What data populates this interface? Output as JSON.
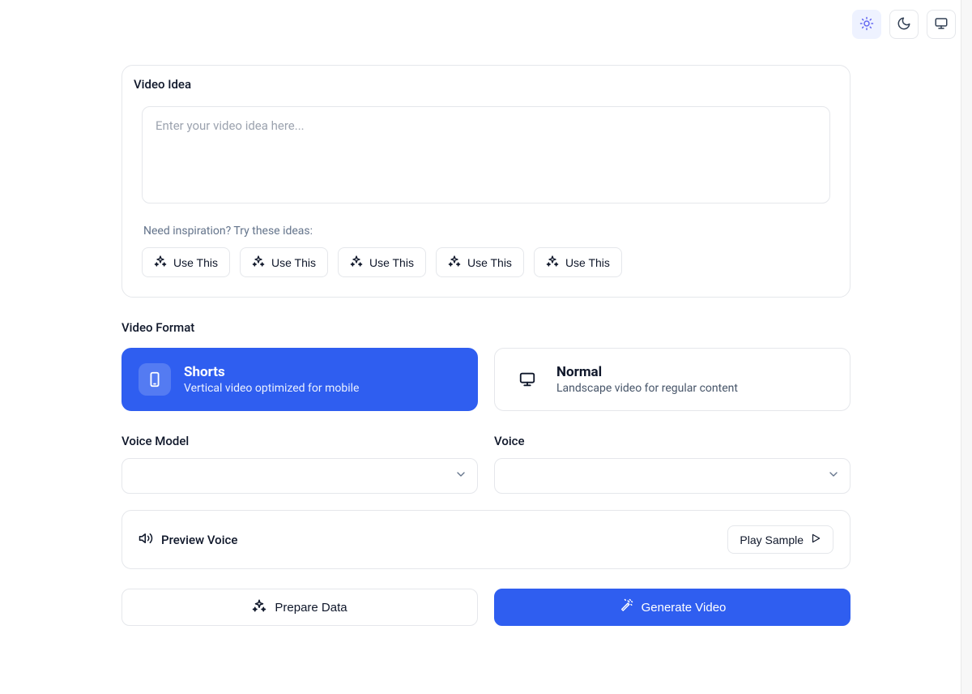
{
  "topbar": {
    "light_tooltip": "Light theme",
    "dark_tooltip": "Dark theme",
    "system_tooltip": "System theme"
  },
  "idea": {
    "title": "Video Idea",
    "placeholder": "Enter your video idea here...",
    "value": "",
    "inspiration_label": "Need inspiration? Try these ideas:",
    "suggestions": [
      {
        "label": "Use This"
      },
      {
        "label": "Use This"
      },
      {
        "label": "Use This"
      },
      {
        "label": "Use This"
      },
      {
        "label": "Use This"
      }
    ]
  },
  "format": {
    "title": "Video Format",
    "options": [
      {
        "title": "Shorts",
        "desc": "Vertical video optimized for mobile",
        "selected": true
      },
      {
        "title": "Normal",
        "desc": "Landscape video for regular content",
        "selected": false
      }
    ]
  },
  "voice_model": {
    "label": "Voice Model",
    "value": ""
  },
  "voice": {
    "label": "Voice",
    "value": ""
  },
  "preview": {
    "label": "Preview Voice",
    "play_label": "Play Sample"
  },
  "actions": {
    "prepare_label": "Prepare Data",
    "generate_label": "Generate Video"
  }
}
